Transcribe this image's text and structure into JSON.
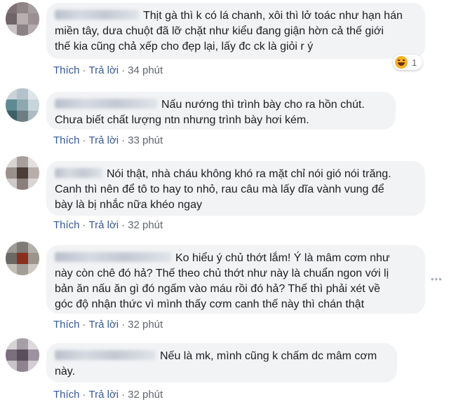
{
  "comments": [
    {
      "text_lines": [
        "Thịt gà thì k có lá chanh, xôi thì lở toác như hạn hán",
        "miền tây, dưa chuột đã lỡ chặt như kiểu đang giận hờn cả thế giới",
        "thế kia cũng chả xếp cho đẹp lại, lấy đc ck là giỏi r ý"
      ],
      "like": "Thích",
      "reply": "Trả lời",
      "time": "34 phút",
      "reaction": {
        "icon": "haha-emoji-icon",
        "count": "1"
      }
    },
    {
      "text_lines": [
        "Nấu nướng thì trình bày cho ra hồn chút.",
        "Chưa biết chất lượng ntn nhưng trình bày hơi kém."
      ],
      "like": "Thích",
      "reply": "Trả lời",
      "time": "33 phút"
    },
    {
      "text_lines": [
        "Nói thật, nhà cháu không khó ra mặt chỉ nói gió nói trăng.",
        "Canh thì nên để tô to hay to nhỏ, rau câu mà lấy dĩa vành vung để",
        "bày là bị nhắc nữa khéo ngay"
      ],
      "like": "Thích",
      "reply": "Trả lời",
      "time": "32 phút"
    },
    {
      "text_lines": [
        "Ko hiểu ý chủ thớt lắm! Ý là mâm cơm như",
        "này còn chê đó hả? Thế theo chủ thớt như này là chuẩn ngon với lị",
        "bản ăn nấu ăn gì đó ngấm vào máu rồi đó hả? Thế thì phải xét về",
        "góc độ nhận thức vì mình thấy cơm canh thế này thì chán thật"
      ],
      "like": "Thích",
      "reply": "Trả lời",
      "time": "32 phút"
    },
    {
      "text_lines": [
        "Nếu là mk, mình cũng k chấm dc mâm cơm",
        "này."
      ],
      "like": "Thích",
      "reply": "Trả lời",
      "time": "32 phút"
    }
  ],
  "more_icon": "more-options-icon",
  "colors": {
    "bubble": "#f2f3f5",
    "link": "#385898",
    "meta": "#606770"
  }
}
